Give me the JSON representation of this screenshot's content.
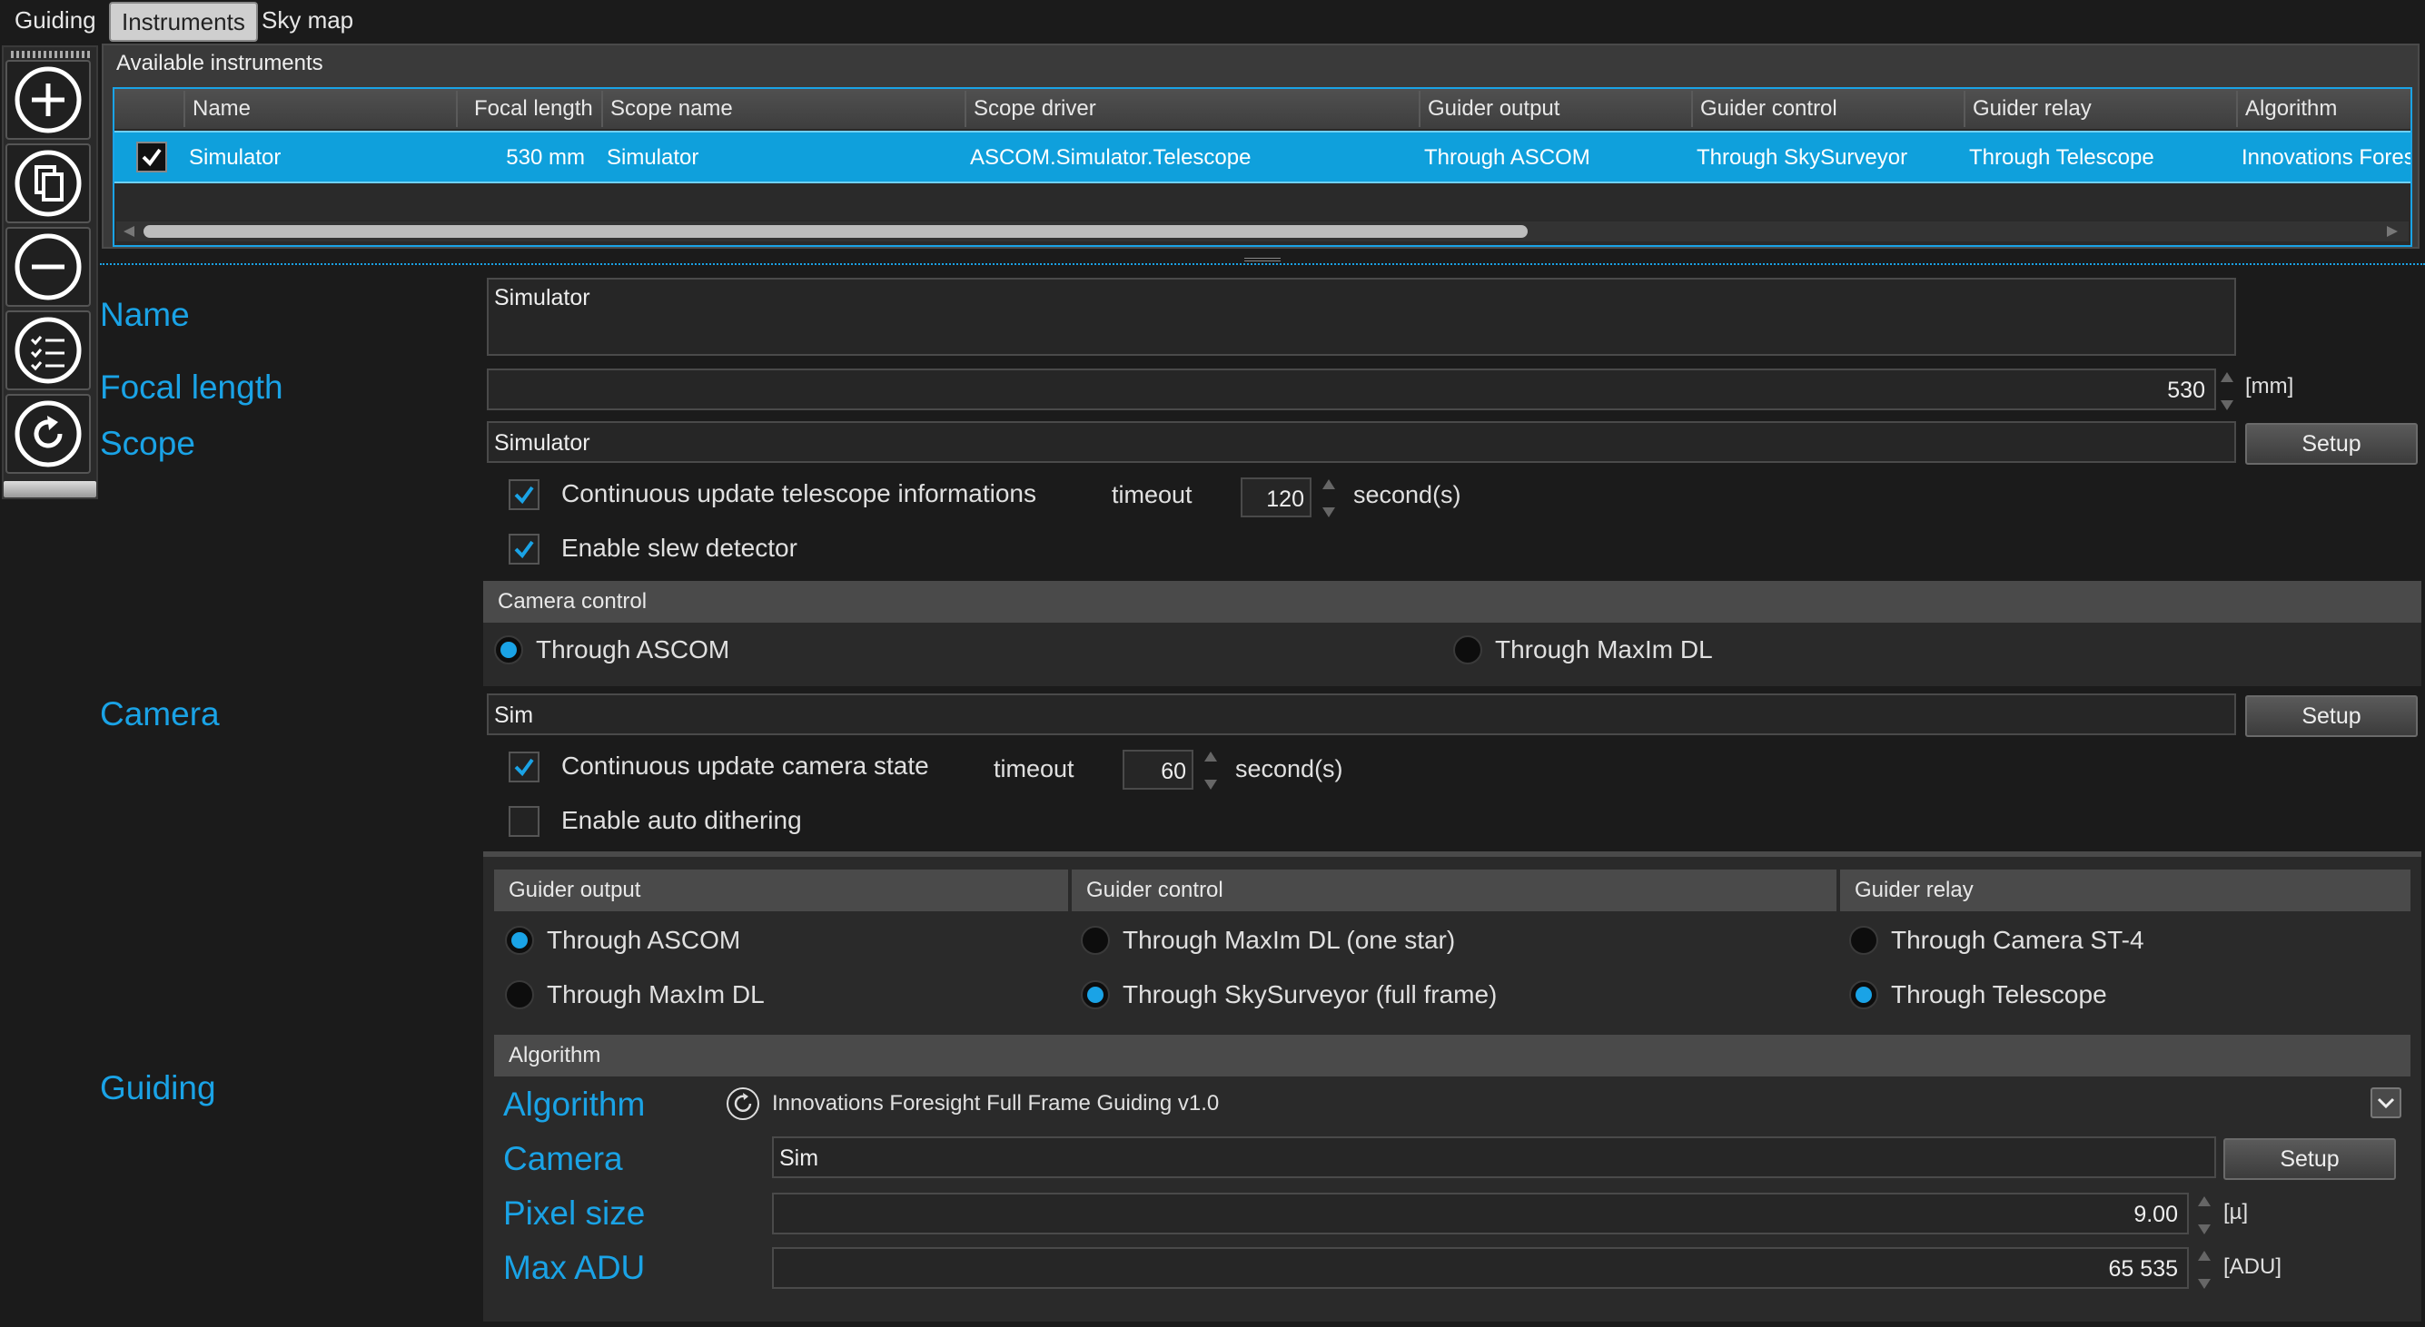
{
  "tabs": [
    {
      "label": "Guiding"
    },
    {
      "label": "Instruments"
    },
    {
      "label": "Sky map"
    }
  ],
  "toolbar": {
    "add": "plus-circle-icon",
    "copy": "copy-icon",
    "remove": "minus-circle-icon",
    "checklist": "checklist-icon",
    "refresh": "refresh-icon"
  },
  "instruments": {
    "header": "Available instruments",
    "columns": [
      "Name",
      "Focal length",
      "Scope name",
      "Scope driver",
      "Guider output",
      "Guider control",
      "Guider relay",
      "Algorithm"
    ],
    "rows": [
      {
        "checked": true,
        "name": "Simulator",
        "focal_length": "530 mm",
        "scope_name": "Simulator",
        "scope_driver": "ASCOM.Simulator.Telescope",
        "guider_output": "Through ASCOM",
        "guider_control": "Through SkySurveyor",
        "guider_relay": "Through Telescope",
        "algorithm": "Innovations Fores"
      }
    ]
  },
  "form": {
    "name_label": "Name",
    "name_value": "Simulator",
    "focal_label": "Focal length",
    "focal_value": "530",
    "focal_unit": "[mm]",
    "scope_label": "Scope",
    "scope_value": "Simulator",
    "setup": "Setup",
    "cont_update_tel": "Continuous update telescope informations",
    "timeout_label": "timeout",
    "tel_timeout": "120",
    "seconds": "second(s)",
    "slew_detector": "Enable slew detector",
    "camera_control_header": "Camera control",
    "cc_ascom": "Through ASCOM",
    "cc_maxim": "Through MaxIm DL",
    "camera_label": "Camera",
    "camera_value": "Sim",
    "cont_update_cam": "Continuous update camera state",
    "cam_timeout": "60",
    "auto_dither": "Enable auto dithering",
    "guiding_label": "Guiding"
  },
  "guider": {
    "output_header": "Guider output",
    "output_ascom": "Through ASCOM",
    "output_maxim": "Through MaxIm DL",
    "control_header": "Guider control",
    "control_maxim": "Through MaxIm DL (one star)",
    "control_sky": "Through SkySurveyor (full frame)",
    "relay_header": "Guider relay",
    "relay_st4": "Through Camera ST-4",
    "relay_tel": "Through Telescope",
    "algorithm_header": "Algorithm",
    "algorithm_label": "Algorithm",
    "algorithm_value": "Innovations Foresight Full Frame Guiding v1.0",
    "camera_label": "Camera",
    "camera_value": "Sim",
    "pixel_label": "Pixel size",
    "pixel_value": "9.00",
    "pixel_unit": "[µ]",
    "adu_label": "Max ADU",
    "adu_value": "65 535",
    "adu_unit": "[ADU]"
  },
  "colors": {
    "accent": "#1aa3e6",
    "selection": "#0fa0dc",
    "background": "#1b1b1b"
  }
}
